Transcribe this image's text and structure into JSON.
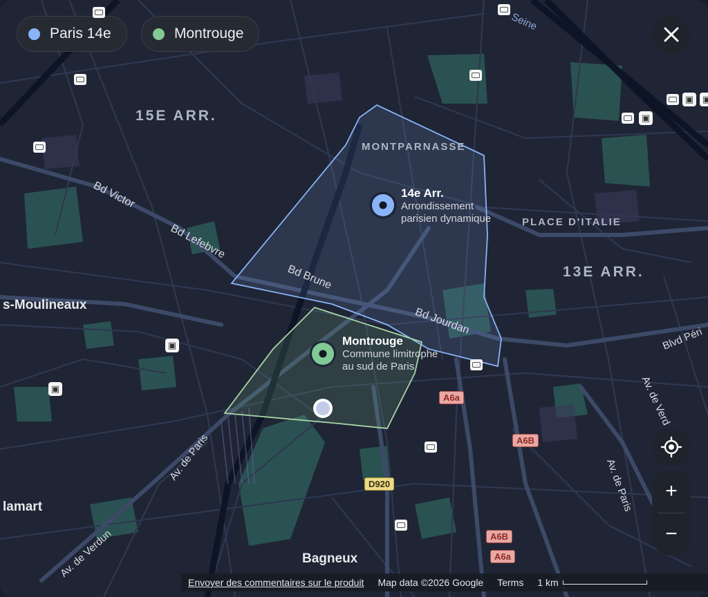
{
  "chips": [
    {
      "label": "Paris 14e",
      "color": "#8ab4f8"
    },
    {
      "label": "Montrouge",
      "color": "#81c995"
    }
  ],
  "districts": {
    "arr15": "15E ARR.",
    "arr13": "13E ARR.",
    "montparnasse": "MONTPARNASSE",
    "place_italie": "PLACE D'ITALIE"
  },
  "towns": {
    "moulineaux": "s-Moulineaux",
    "clamart": "lamart",
    "bagneux": "Bagneux"
  },
  "roads": {
    "bd_victor": "Bd Victor",
    "bd_lefebvre": "Bd Lefebvre",
    "bd_brune": "Bd Brune",
    "bd_jourdan": "Bd Jourdan",
    "blvd_peri": "Blvd Péri",
    "av_verdun": "Av. de Verdun",
    "av_paris_left": "Av. de Paris",
    "av_paris_right": "Av. de Paris",
    "av_verdun_right": "Av. de Verd",
    "seine": "Seine"
  },
  "shields": {
    "a6a_1": "A6a",
    "a6b_1": "A6B",
    "d920": "D920",
    "a6b_2": "A6B",
    "a6a_2": "A6a"
  },
  "places": [
    {
      "title": "14e Arr.",
      "subtitle_1": "Arrondissement",
      "subtitle_2": "parisien dynamique",
      "color": "#8ab4f8"
    },
    {
      "title": "Montrouge",
      "subtitle_1": "Commune limitrophe",
      "subtitle_2": "au sud de Paris",
      "color": "#81c995"
    }
  ],
  "controls": {
    "close_icon": "close-icon",
    "locate_icon": "my-location-icon",
    "zoom_in": "+",
    "zoom_out": "−"
  },
  "footer": {
    "feedback": "Envoyer des commentaires sur le produit",
    "map_data": "Map data ©2026 Google",
    "terms": "Terms",
    "scale": "1 km"
  },
  "colors": {
    "land": "#1f2535",
    "park": "#2d5a57",
    "road": "#3c4a68",
    "rail": "#0c1426",
    "paris14_fill": "#8ab4f8",
    "montrouge_fill": "#81c995"
  }
}
